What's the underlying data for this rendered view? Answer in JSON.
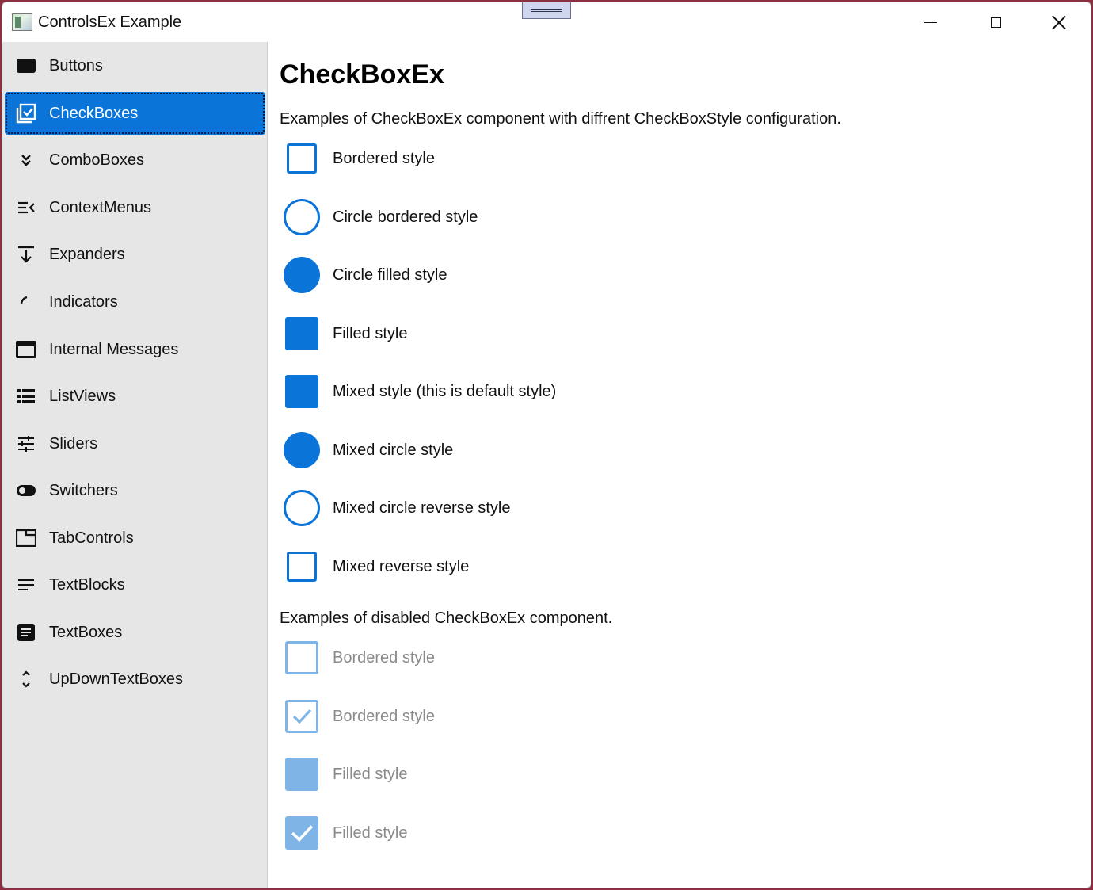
{
  "window": {
    "title": "ControlsEx Example"
  },
  "sidebar": {
    "items": [
      {
        "label": "Buttons",
        "icon": "button-icon"
      },
      {
        "label": "CheckBoxes",
        "icon": "checkbox-icon",
        "selected": true
      },
      {
        "label": "ComboBoxes",
        "icon": "double-chevron-down-icon"
      },
      {
        "label": "ContextMenus",
        "icon": "menu-collapse-icon"
      },
      {
        "label": "Expanders",
        "icon": "expand-arrow-icon"
      },
      {
        "label": "Indicators",
        "icon": "progress-arc-icon"
      },
      {
        "label": "Internal Messages",
        "icon": "message-window-icon"
      },
      {
        "label": "ListViews",
        "icon": "list-view-icon"
      },
      {
        "label": "Sliders",
        "icon": "sliders-icon"
      },
      {
        "label": "Switchers",
        "icon": "toggle-icon"
      },
      {
        "label": "TabControls",
        "icon": "tab-icon"
      },
      {
        "label": "TextBlocks",
        "icon": "text-lines-icon"
      },
      {
        "label": "TextBoxes",
        "icon": "text-box-icon"
      },
      {
        "label": "UpDownTextBoxes",
        "icon": "up-down-icon"
      }
    ]
  },
  "main": {
    "heading": "CheckBoxEx",
    "description": "Examples of CheckBoxEx component with diffrent CheckBoxStyle configuration.",
    "checkboxes": [
      {
        "label": "Bordered style",
        "style": "bordered"
      },
      {
        "label": "Circle bordered style",
        "style": "circle-bordered"
      },
      {
        "label": "Circle filled style",
        "style": "circle-filled"
      },
      {
        "label": "Filled style",
        "style": "filled"
      },
      {
        "label": "Mixed style (this is default style)",
        "style": "filled"
      },
      {
        "label": "Mixed circle style",
        "style": "circle-filled"
      },
      {
        "label": "Mixed circle reverse style",
        "style": "circle-bordered"
      },
      {
        "label": "Mixed reverse style",
        "style": "bordered"
      }
    ],
    "disabled_description": "Examples of disabled CheckBoxEx component.",
    "disabled_checkboxes": [
      {
        "label": "Bordered style",
        "style": "bordered",
        "checked": false
      },
      {
        "label": "Bordered style",
        "style": "bordered",
        "checked": true
      },
      {
        "label": "Filled style",
        "style": "filled",
        "checked": false
      },
      {
        "label": "Filled style",
        "style": "filled",
        "checked": true
      }
    ]
  },
  "colors": {
    "accent": "#0a74d8",
    "accent_disabled": "#7fb5e6",
    "sidebar_bg": "#e6e6e6"
  }
}
